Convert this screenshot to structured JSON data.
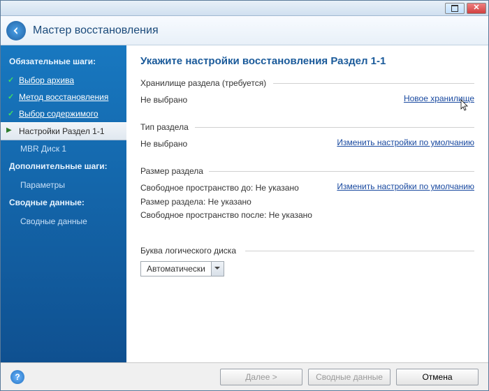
{
  "window": {
    "title": "Мастер восстановления"
  },
  "sidebar": {
    "section_required": "Обязательные шаги:",
    "section_optional": "Дополнительные шаги:",
    "section_summary": "Сводные данные:",
    "items": {
      "archive": "Выбор архива",
      "method": "Метод восстановления",
      "content": "Выбор содержимого",
      "settings": "Настройки Раздел 1-1",
      "mbr": "MBR Диск 1",
      "params": "Параметры",
      "summary": "Сводные данные"
    }
  },
  "content": {
    "heading": "Укажите настройки восстановления Раздел 1-1",
    "storage": {
      "label": "Хранилище раздела (требуется)",
      "value": "Не выбрано",
      "link": "Новое хранилище"
    },
    "type": {
      "label": "Тип раздела",
      "value": "Не выбрано",
      "link": "Изменить настройки по умолчанию"
    },
    "size": {
      "label": "Размер раздела",
      "free_before": "Свободное пространство до: Не указано",
      "size_val": "Размер раздела: Не указано",
      "free_after": "Свободное пространство после: Не указано",
      "link": "Изменить настройки по умолчанию"
    },
    "drive_letter": {
      "label": "Буква логического диска",
      "value": "Автоматически"
    }
  },
  "footer": {
    "next": "Далее >",
    "summary": "Сводные данные",
    "cancel": "Отмена"
  }
}
